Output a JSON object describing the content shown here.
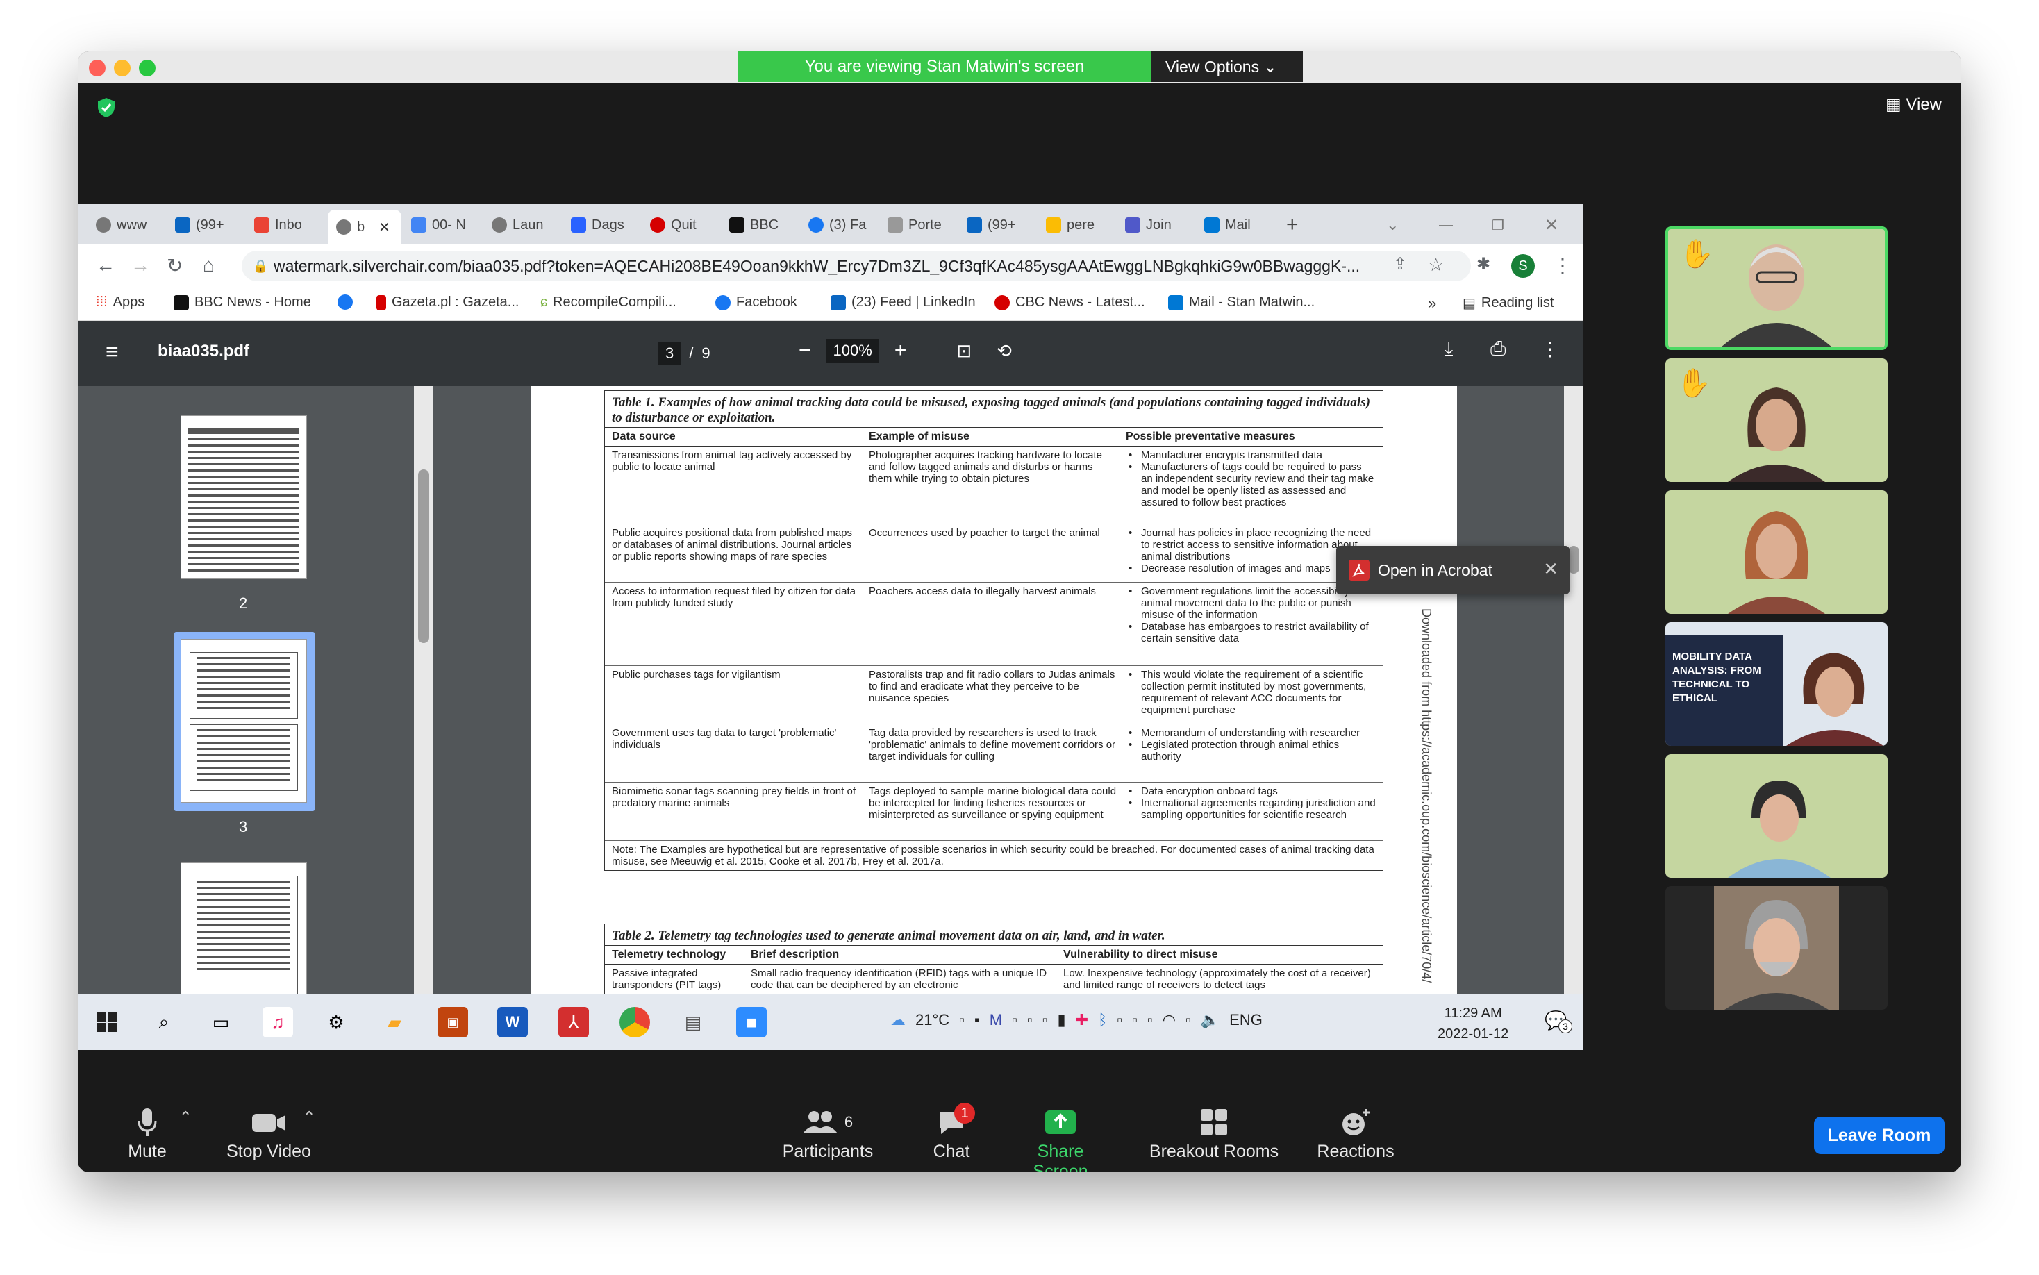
{
  "zoom_window": {
    "banner": "You are viewing Stan Matwin's screen",
    "view_options": "View Options",
    "view_button": "View"
  },
  "browser": {
    "tabs": [
      "www",
      "(99+",
      "Inbo",
      "b",
      "00- N",
      "Laun",
      "Dags",
      "Quit",
      "BBC",
      "(3) Fa",
      "Porte",
      "(99+",
      "pere",
      "Join",
      "Mail"
    ],
    "address": "watermark.silverchair.com/biaa035.pdf?token=AQECAHi208BE49Ooan9kkhW_Ercy7Dm3ZL_9Cf3qfKAc485ysgAAAtEwggLNBgkqhkiG9w0BBwagggK-...",
    "profile_initial": "S",
    "bookmarks": [
      "Apps",
      "BBC News - Home",
      "Gazeta.pl : Gazeta...",
      "RecompileCompili...",
      "Facebook",
      "(23) Feed | LinkedIn",
      "CBC News - Latest...",
      "Mail - Stan Matwin..."
    ],
    "bookmarks_overflow": "»",
    "reading_list": "Reading list"
  },
  "pdf": {
    "filename": "biaa035.pdf",
    "current_page": "3",
    "page_sep": "/",
    "total_pages": "9",
    "zoom": "100%",
    "thumbnail_labels": [
      "2",
      "3"
    ],
    "open_in_acrobat": "Open in Acrobat",
    "watermark": "Downloaded from https://academic.oup.com/bioscience/article/70/4/",
    "table1": {
      "caption": "Table 1. Examples of how animal tracking data could be misused, exposing tagged animals (and populations containing tagged individuals) to disturbance or exploitation.",
      "headers": [
        "Data source",
        "Example of misuse",
        "Possible preventative measures"
      ],
      "rows": [
        {
          "source": "Transmissions from animal tag actively accessed by public to locate animal",
          "misuse": "Photographer acquires tracking hardware to locate and follow tagged animals and disturbs or harms them while trying to obtain pictures",
          "measures": [
            "Manufacturer encrypts transmitted data",
            "Manufacturers of tags could be required to pass an independent security review and their tag make and model be openly listed as assessed and assured to follow best practices"
          ]
        },
        {
          "source": "Public acquires positional data from published maps or databases of animal distributions. Journal articles or public reports showing maps of rare species",
          "misuse": "Occurrences used by poacher to target the animal",
          "measures": [
            "Journal has policies in place recognizing the need to restrict access to sensitive information about animal distributions",
            "Decrease resolution of images and maps"
          ]
        },
        {
          "source": "Access to information request filed by citizen for data from publicly funded study",
          "misuse": "Poachers access data to illegally harvest animals",
          "measures": [
            "Government regulations limit the accessibility of animal movement data to the public or punish misuse of the information",
            "Database has embargoes to restrict availability of certain sensitive data"
          ]
        },
        {
          "source": "Public purchases tags for vigilantism",
          "misuse": "Pastoralists trap and fit radio collars to Judas animals to find and eradicate what they perceive to be nuisance species",
          "measures": [
            "This would violate the requirement of a scientific collection permit instituted by most governments, requirement of relevant ACC documents for equipment purchase"
          ]
        },
        {
          "source": "Government uses tag data to target 'problematic' individuals",
          "misuse": "Tag data provided by researchers is used to track 'problematic' animals to define movement corridors or target individuals for culling",
          "measures": [
            "Memorandum of understanding with researcher",
            "Legislated protection through animal ethics authority"
          ]
        },
        {
          "source": "Biomimetic sonar tags scanning prey fields in front of predatory marine animals",
          "misuse": "Tags deployed to sample marine biological data could be intercepted for finding fisheries resources or misinterpreted as surveillance or spying equipment",
          "measures": [
            "Data encryption onboard tags",
            "International agreements regarding jurisdiction and sampling opportunities for scientific research"
          ]
        }
      ],
      "note": "Note: The Examples are hypothetical but are representative of possible scenarios in which security could be breached. For documented cases of animal tracking data misuse, see Meeuwig et al. 2015, Cooke et al. 2017b, Frey et al. 2017a."
    },
    "table2": {
      "caption": "Table 2. Telemetry tag technologies used to generate animal movement data on air, land, and in water.",
      "headers": [
        "Telemetry technology",
        "Brief description",
        "Vulnerability to direct misuse"
      ],
      "row": {
        "tech": "Passive integrated transponders (PIT tags)",
        "desc": "Small radio frequency identification (RFID) tags with a unique ID code that can be deciphered by an electronic",
        "vuln": "Low. Inexpensive technology (approximately the cost of a receiver) and limited range of receivers to detect tags"
      }
    }
  },
  "taskbar": {
    "temperature": "21°C",
    "language": "ENG",
    "time": "11:29 AM",
    "date": "2022-01-12",
    "notifications": "3"
  },
  "participant_slide": {
    "line1": "MOBILITY DATA",
    "line2": "ANALYSIS: FROM",
    "line3": "TECHNICAL TO ETHICAL"
  },
  "controls": {
    "mute": "Mute",
    "stop_video": "Stop Video",
    "participants": "Participants",
    "participants_count": "6",
    "chat": "Chat",
    "chat_badge": "1",
    "share_screen": "Share Screen",
    "breakout_rooms": "Breakout Rooms",
    "reactions": "Reactions",
    "leave_room": "Leave Room"
  },
  "colors": {
    "share_green": "#39c84b",
    "leave_blue": "#0e72ed",
    "tile_bg": "#c5d6a0",
    "selected_border": "#4cd964"
  }
}
